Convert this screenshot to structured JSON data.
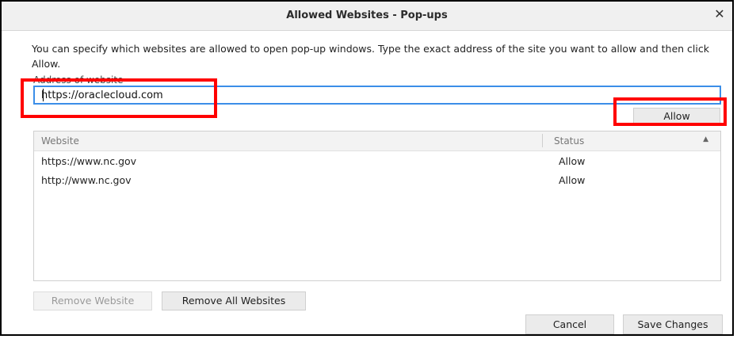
{
  "window": {
    "title": "Allowed Websites - Pop-ups",
    "close_glyph": "✕"
  },
  "description": "You can specify which websites are allowed to open pop-up windows. Type the exact address of the site you want to allow and then click Allow.",
  "address": {
    "label": "Address of website",
    "value": "https://oraclecloud.com"
  },
  "allow_button": "Allow",
  "table": {
    "columns": [
      "Website",
      "Status"
    ],
    "sort_indicator": "▲",
    "rows": [
      {
        "website": "https://www.nc.gov",
        "status": "Allow"
      },
      {
        "website": "http://www.nc.gov",
        "status": "Allow"
      }
    ]
  },
  "buttons": {
    "remove_website": "Remove Website",
    "remove_all": "Remove All Websites",
    "cancel": "Cancel",
    "save": "Save Changes"
  },
  "colors": {
    "highlight": "#ff0000",
    "focus_border": "#3b8ee8"
  }
}
